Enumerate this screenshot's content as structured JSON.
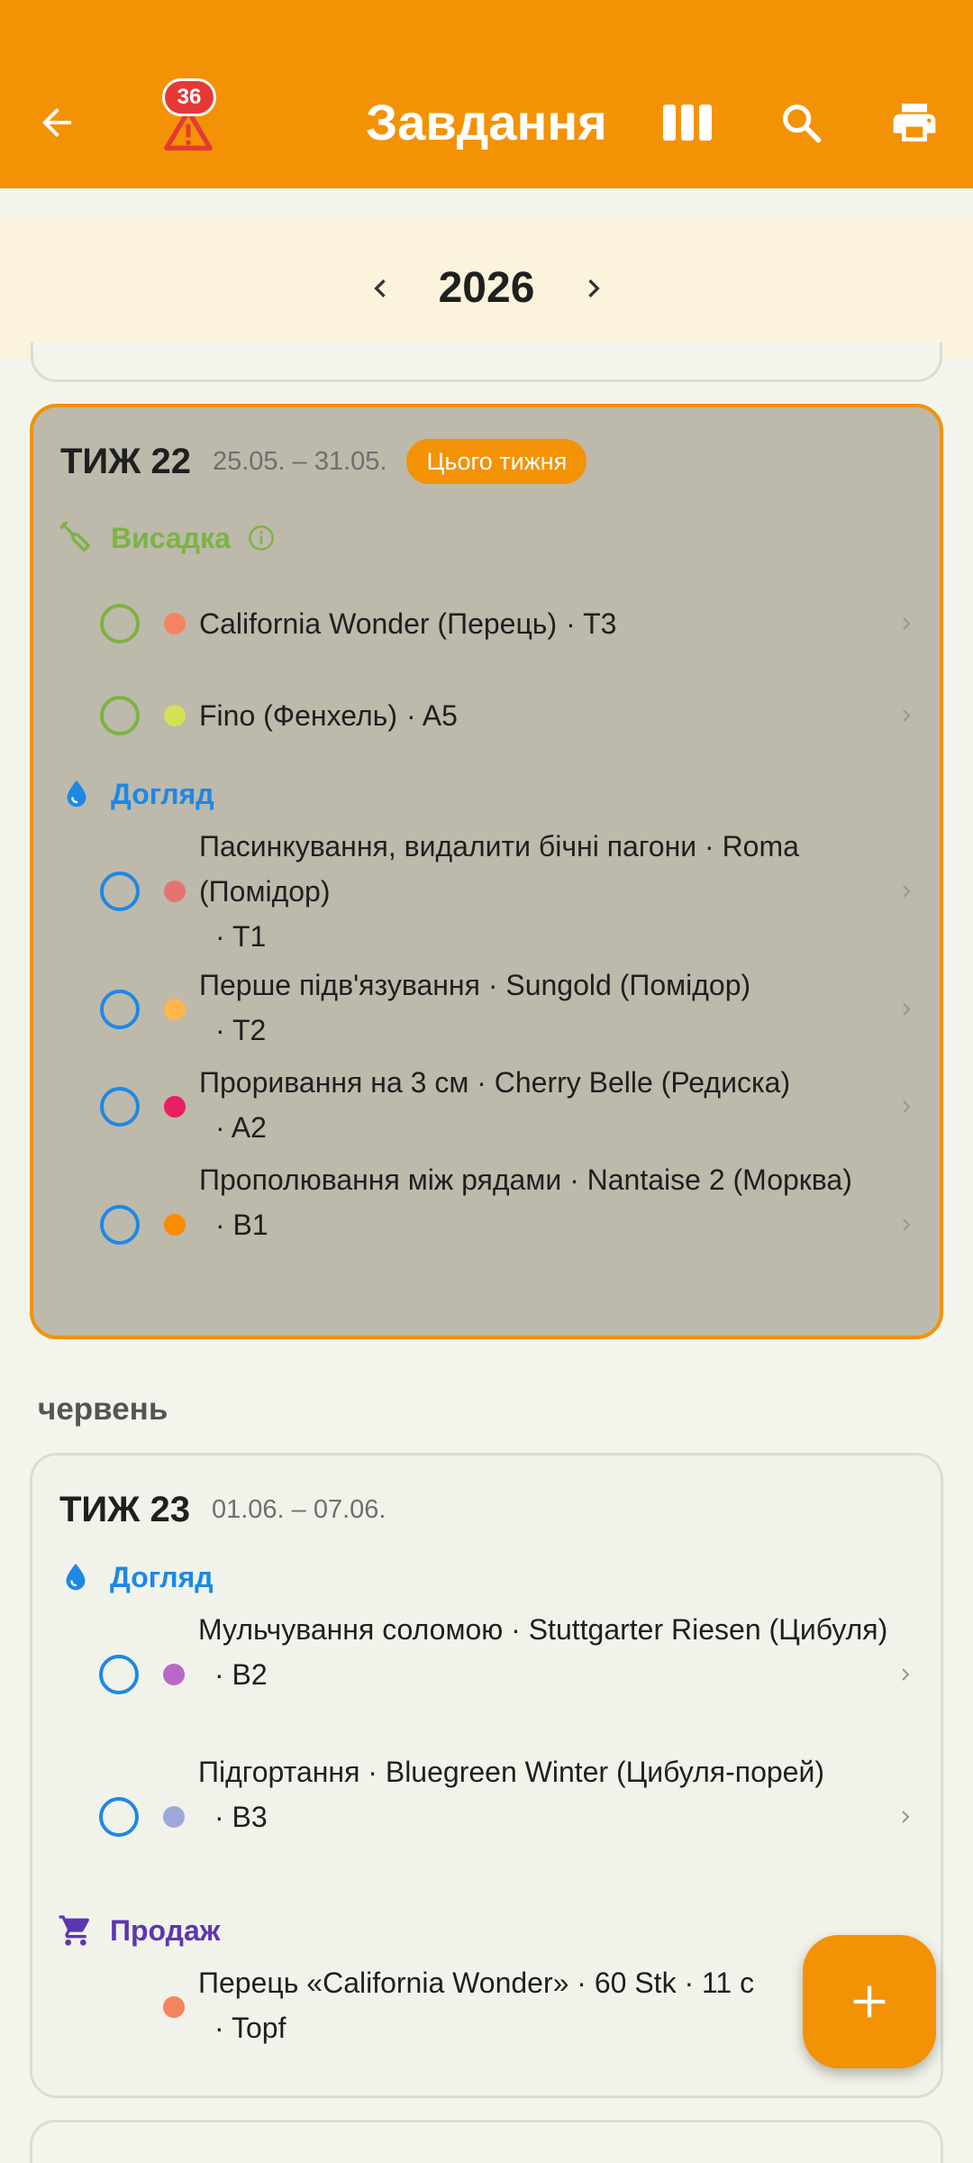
{
  "appbar": {
    "title": "Завдання",
    "warning_count": "36",
    "icons": [
      "back-arrow-icon",
      "warning-icon",
      "columns-view-icon",
      "search-icon",
      "print-icon"
    ]
  },
  "year_selector": {
    "year": "2026"
  },
  "colors": {
    "accent": "#f39205",
    "planting": "#7cb342",
    "care": "#1e88e5",
    "sales": "#5e35b1"
  },
  "weeks": [
    {
      "title": "ТИЖ 22",
      "range": "25.05. – 31.05.",
      "chip": "Цього тижня",
      "sections": [
        {
          "label": "Висадка",
          "tasks": [
            {
              "text": "California Wonder (Перець)",
              "loc": "· T3",
              "dot": "#f4845f"
            },
            {
              "text": "Fino (Фенхель)",
              "loc": "· A5",
              "dot": "#d4e157"
            }
          ]
        },
        {
          "label": "Догляд",
          "tasks": [
            {
              "text": "Пасинкування, видалити бічні пагони · Roma (Помідор)",
              "loc": "· T1",
              "dot": "#e57373"
            },
            {
              "text": "Перше підв'язування · Sungold (Помідор)",
              "loc": "· T2",
              "dot": "#ffb74d"
            },
            {
              "text": "Проривання на 3 см · Cherry Belle (Редиска)",
              "loc": "· A2",
              "dot": "#e91e63"
            },
            {
              "text": "Прополювання між рядами · Nantaise 2 (Морква)",
              "loc": "· B1",
              "dot": "#fb8c00"
            }
          ]
        }
      ]
    },
    {
      "month": "червень",
      "title": "ТИЖ 23",
      "range": "01.06. – 07.06.",
      "sections": [
        {
          "label": "Догляд",
          "tasks": [
            {
              "text": "Мульчування соломою · Stuttgarter Riesen (Цибуля)",
              "loc": "· B2",
              "dot": "#ba68c8"
            },
            {
              "text": "Підгортання · Bluegreen Winter (Цибуля-порей)",
              "loc": "· B3",
              "dot": "#9fa8da"
            }
          ]
        },
        {
          "label": "Продаж",
          "tasks": [
            {
              "text": "Перець «California Wonder» · 60 Stk · 11 c",
              "loc": "· Topf",
              "dot": "#f4845f"
            }
          ]
        }
      ]
    }
  ],
  "fab": {
    "icon": "plus-icon"
  }
}
